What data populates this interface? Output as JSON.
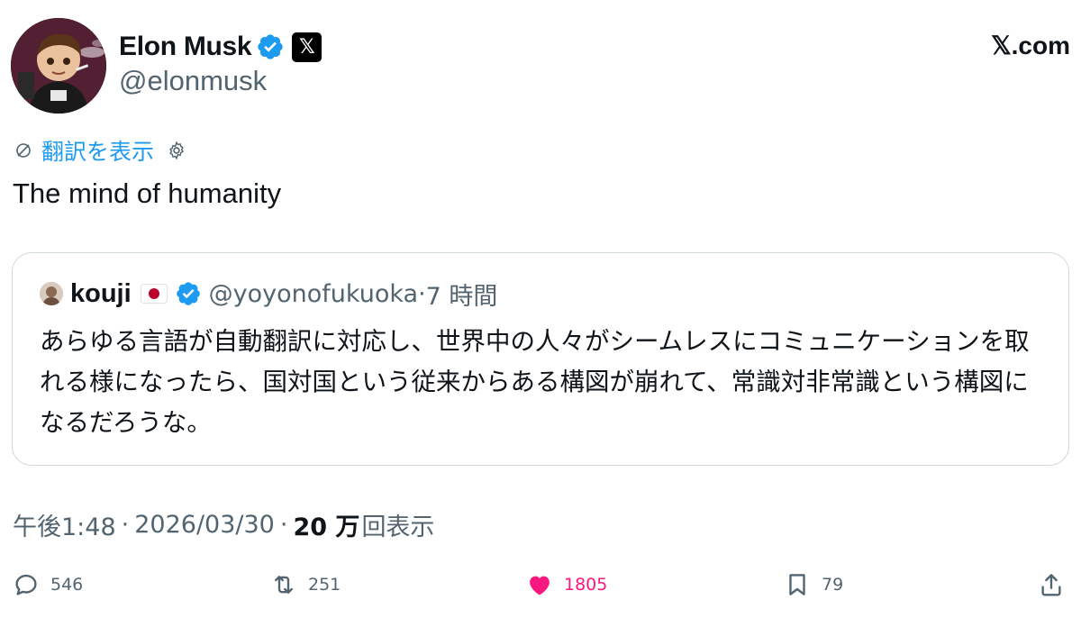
{
  "author": {
    "name": "Elon Musk",
    "handle": "@elonmusk",
    "x_badge": "𝕏"
  },
  "site_logo": "𝕏.com",
  "translate": {
    "label": "翻訳を表示"
  },
  "tweet": {
    "text": "The mind of humanity"
  },
  "quoted": {
    "name": "kouji",
    "handle": "@yoyonofukuoka",
    "dot": "·",
    "time": "7 時間",
    "text": "あらゆる言語が自動翻訳に対応し、世界中の人々がシームレスにコミュニケーションを取れる様になったら、国対国という従来からある構図が崩れて、常識対非常識という構図になるだろうな。"
  },
  "meta": {
    "time": "午後1:48",
    "sep1": "·",
    "date": "2026/03/30",
    "sep2": "·",
    "views_count": "20 万",
    "views_label": "回表示"
  },
  "actions": {
    "replies": "546",
    "reposts": "251",
    "likes": "1805",
    "bookmarks": "79"
  },
  "icons": [
    "translate-icon",
    "gear-icon",
    "verified-icon",
    "reply-icon",
    "repost-icon",
    "heart-icon",
    "bookmark-icon",
    "share-icon"
  ],
  "colors": {
    "link_blue": "#1d9bf0",
    "verified_blue": "#1d9bf0",
    "like_pink": "#f91880",
    "muted_gray": "#536471",
    "text": "#0f1419"
  }
}
